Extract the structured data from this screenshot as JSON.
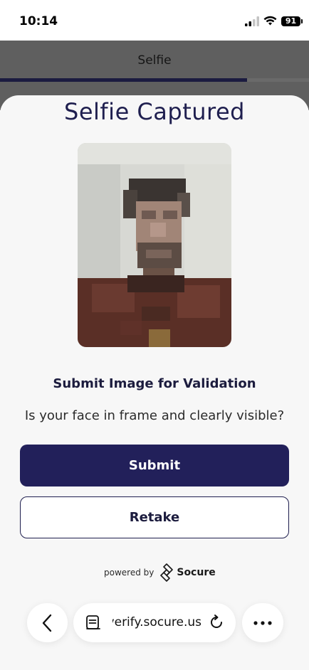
{
  "status_bar": {
    "time": "10:14",
    "battery": "91"
  },
  "header": {
    "title": "Selfie",
    "progress": 0.8
  },
  "sheet": {
    "title": "Selfie Captured",
    "subtitle": "Submit Image for Validation",
    "question": "Is your face in frame and clearly visible?",
    "submit_label": "Submit",
    "retake_label": "Retake",
    "powered_by": "powered by",
    "brand": "Socure"
  },
  "browser": {
    "url": "verify.socure.us",
    "icons": [
      "chevron-left-icon",
      "tabs-icon",
      "reload-icon",
      "more-icon"
    ]
  },
  "colors": {
    "primary": "#22205a",
    "title": "#1f1f4f",
    "sheet_bg": "#f7f7f7",
    "overlay": "#5f5f5f"
  }
}
